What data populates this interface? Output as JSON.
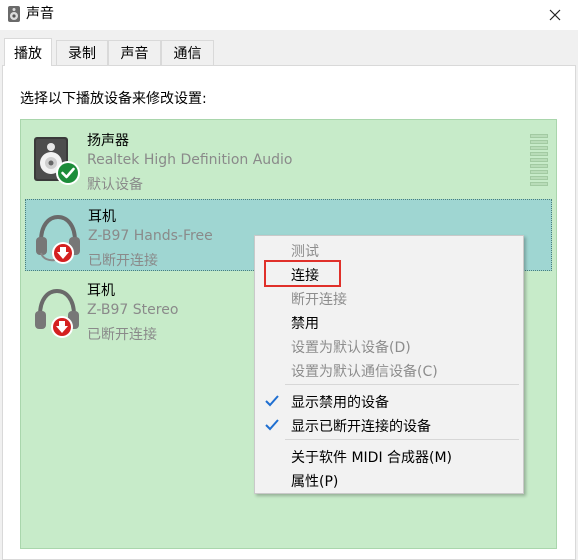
{
  "window": {
    "title": "声音",
    "icons": {
      "app": "speaker-icon",
      "close": "close-icon"
    }
  },
  "tabs": [
    {
      "label": "播放",
      "active": true
    },
    {
      "label": "录制",
      "active": false
    },
    {
      "label": "声音",
      "active": false
    },
    {
      "label": "通信",
      "active": false
    }
  ],
  "instruction": "选择以下播放设备来修改设置:",
  "devices": [
    {
      "name": "扬声器",
      "description": "Realtek High Definition Audio",
      "status": "默认设备",
      "icon": "speaker-device-icon",
      "badge": "green-check-icon",
      "selected": false
    },
    {
      "name": "耳机",
      "description": "Z-B97 Hands-Free",
      "status": "已断开连接",
      "icon": "headset-icon",
      "badge": "red-down-arrow-icon",
      "selected": true
    },
    {
      "name": "耳机",
      "description": "Z-B97 Stereo",
      "status": "已断开连接",
      "icon": "headset-icon",
      "badge": "red-down-arrow-icon",
      "selected": false
    }
  ],
  "context_menu": {
    "items": [
      {
        "label": "测试",
        "enabled": false,
        "checked": false
      },
      {
        "label": "连接",
        "enabled": true,
        "checked": false,
        "highlighted": true
      },
      {
        "label": "断开连接",
        "enabled": false,
        "checked": false
      },
      {
        "label": "禁用",
        "enabled": true,
        "checked": false
      },
      {
        "label": "设置为默认设备(D)",
        "enabled": false,
        "checked": false
      },
      {
        "label": "设置为默认通信设备(C)",
        "enabled": false,
        "checked": false
      },
      {
        "label": "显示禁用的设备",
        "enabled": true,
        "checked": true
      },
      {
        "label": "显示已断开连接的设备",
        "enabled": true,
        "checked": true
      },
      {
        "label": "关于软件 MIDI 合成器(M)",
        "enabled": true,
        "checked": false
      },
      {
        "label": "属性(P)",
        "enabled": true,
        "checked": false
      }
    ]
  },
  "colors": {
    "list_bg": "#c7ebc9",
    "selected_bg": "#9fd6d2",
    "check_blue": "#1f6fd1",
    "highlight_red": "#e0302a"
  }
}
